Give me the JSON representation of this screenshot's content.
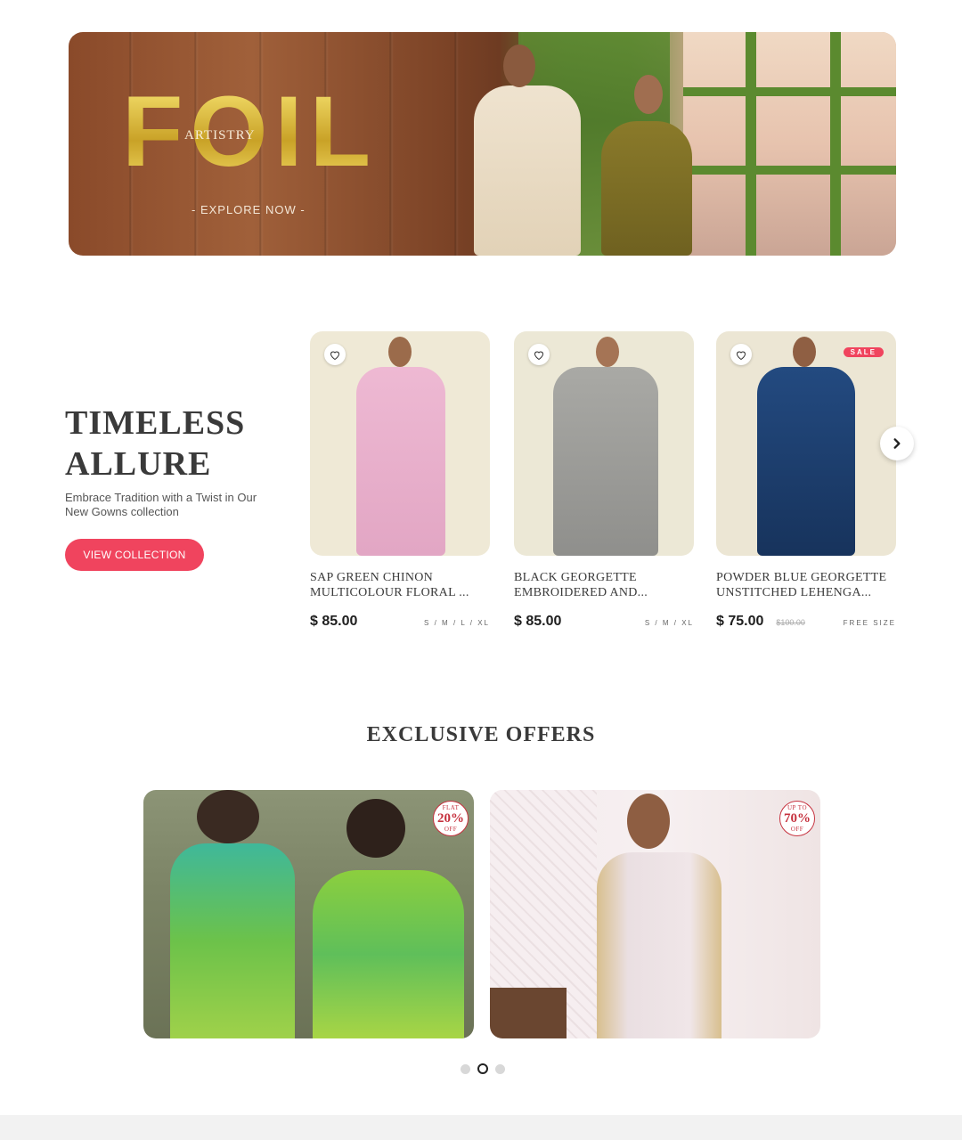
{
  "hero": {
    "brand": "FOIL",
    "subtitle": "ARTISTRY",
    "cta": "- EXPLORE NOW -"
  },
  "collection": {
    "title": "TIMELESS ALLURE",
    "subtitle": "Embrace Tradition with a Twist in Our New Gowns collection",
    "button": "VIEW COLLECTION",
    "products": [
      {
        "name": "SAP GREEN CHINON\nMULTICOLOUR FLORAL ...",
        "price": "$ 85.00",
        "old_price": "",
        "sizes": "S / M / L / XL",
        "sale": "",
        "color": "#e7b7d0"
      },
      {
        "name": "BLACK GEORGETTE\nEMBROIDERED AND...",
        "price": "$ 85.00",
        "old_price": "",
        "sizes": "S / M / XL",
        "sale": "",
        "color": "#9a9a98"
      },
      {
        "name": "POWDER BLUE GEORGETTE\nUNSTITCHED LEHENGA...",
        "price": "$ 75.00",
        "old_price": "$100.00",
        "sizes": "FREE SIZE",
        "sale": "SALE",
        "color": "#1f3f73"
      }
    ]
  },
  "offers": {
    "title": "EXCLUSIVE OFFERS",
    "items": [
      {
        "badge_top": "FLAT",
        "badge_value": "20%",
        "badge_bottom": "OFF"
      },
      {
        "badge_top": "UP TO",
        "badge_value": "70%",
        "badge_bottom": "OFF"
      }
    ],
    "carousel_active": 2
  },
  "colors": {
    "accent": "#f0445e",
    "badge_red": "#c6323f",
    "gold": "#d7b53a"
  },
  "icons": [
    "heart-icon",
    "chevron-right-icon"
  ]
}
